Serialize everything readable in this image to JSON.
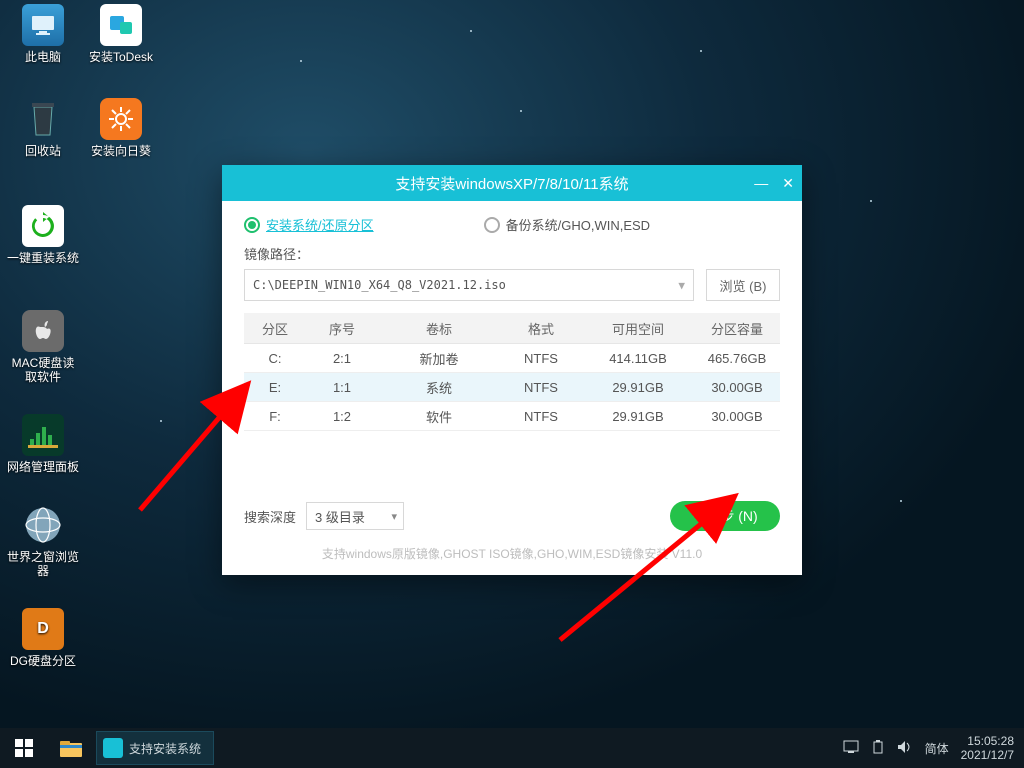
{
  "desktop_icons": [
    {
      "label": "此电脑"
    },
    {
      "label": "安装ToDesk"
    },
    {
      "label": "回收站"
    },
    {
      "label": "安装向日葵"
    },
    {
      "label": "一键重装系统"
    },
    {
      "label": "MAC硬盘读取软件"
    },
    {
      "label": "网络管理面板"
    },
    {
      "label": "世界之窗浏览器"
    },
    {
      "label": "DG硬盘分区"
    }
  ],
  "window": {
    "title": "支持安装windowsXP/7/8/10/11系统",
    "mode_install": "安装系统/还原分区",
    "mode_backup": "备份系统/GHO,WIN,ESD",
    "path_label": "镜像路径：",
    "path_value": "C:\\DEEPIN_WIN10_X64_Q8_V2021.12.iso",
    "browse": "浏览 (B)",
    "headers": {
      "part": "分区",
      "index": "序号",
      "vol": "卷标",
      "fs": "格式",
      "free": "可用空间",
      "size": "分区容量"
    },
    "rows": [
      {
        "part": "C:",
        "index": "2:1",
        "vol": "新加卷",
        "fs": "NTFS",
        "free": "414.11GB",
        "size": "465.76GB",
        "selected": false
      },
      {
        "part": "E:",
        "index": "1:1",
        "vol": "系统",
        "fs": "NTFS",
        "free": "29.91GB",
        "size": "30.00GB",
        "selected": true
      },
      {
        "part": "F:",
        "index": "1:2",
        "vol": "软件",
        "fs": "NTFS",
        "free": "29.91GB",
        "size": "30.00GB",
        "selected": false
      }
    ],
    "depth_label": "搜索深度",
    "depth_value": "3 级目录",
    "next": "下一步 (N)",
    "hint": "支持windows原版镜像,GHOST ISO镜像,GHO,WIM,ESD镜像安装   V11.0"
  },
  "taskbar": {
    "task_label": "支持安装系统",
    "ime": "简体",
    "time": "15:05:28",
    "date": "2021/12/7"
  }
}
